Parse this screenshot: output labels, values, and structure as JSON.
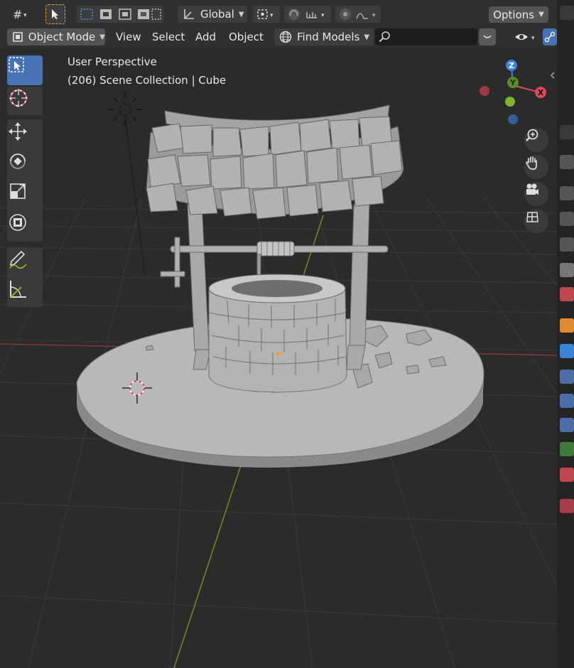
{
  "header": {
    "orientation": "Global",
    "options": "Options",
    "mode": "Object Mode",
    "menus": [
      "View",
      "Select",
      "Add",
      "Object"
    ],
    "find_models": "Find Models",
    "search_placeholder": ""
  },
  "viewport": {
    "perspective_label": "User Perspective",
    "collection_label": "(206) Scene Collection | Cube"
  },
  "gizmo": {
    "z": "Z",
    "y": "Y",
    "x": "X"
  },
  "colors": {
    "accent": "#4772b3",
    "axis_x": "#e04b5c",
    "axis_y": "#7fb52c",
    "axis_z": "#3b85d6",
    "select_outline": "#f0a02c"
  },
  "icons": {
    "tools": [
      "select-box-icon",
      "cursor-icon",
      "move-icon",
      "rotate-icon",
      "scale-icon",
      "transform-icon",
      "annotate-icon",
      "measure-icon"
    ],
    "nav": [
      "zoom-icon",
      "hand-icon",
      "camera-icon",
      "grid-icon"
    ]
  }
}
